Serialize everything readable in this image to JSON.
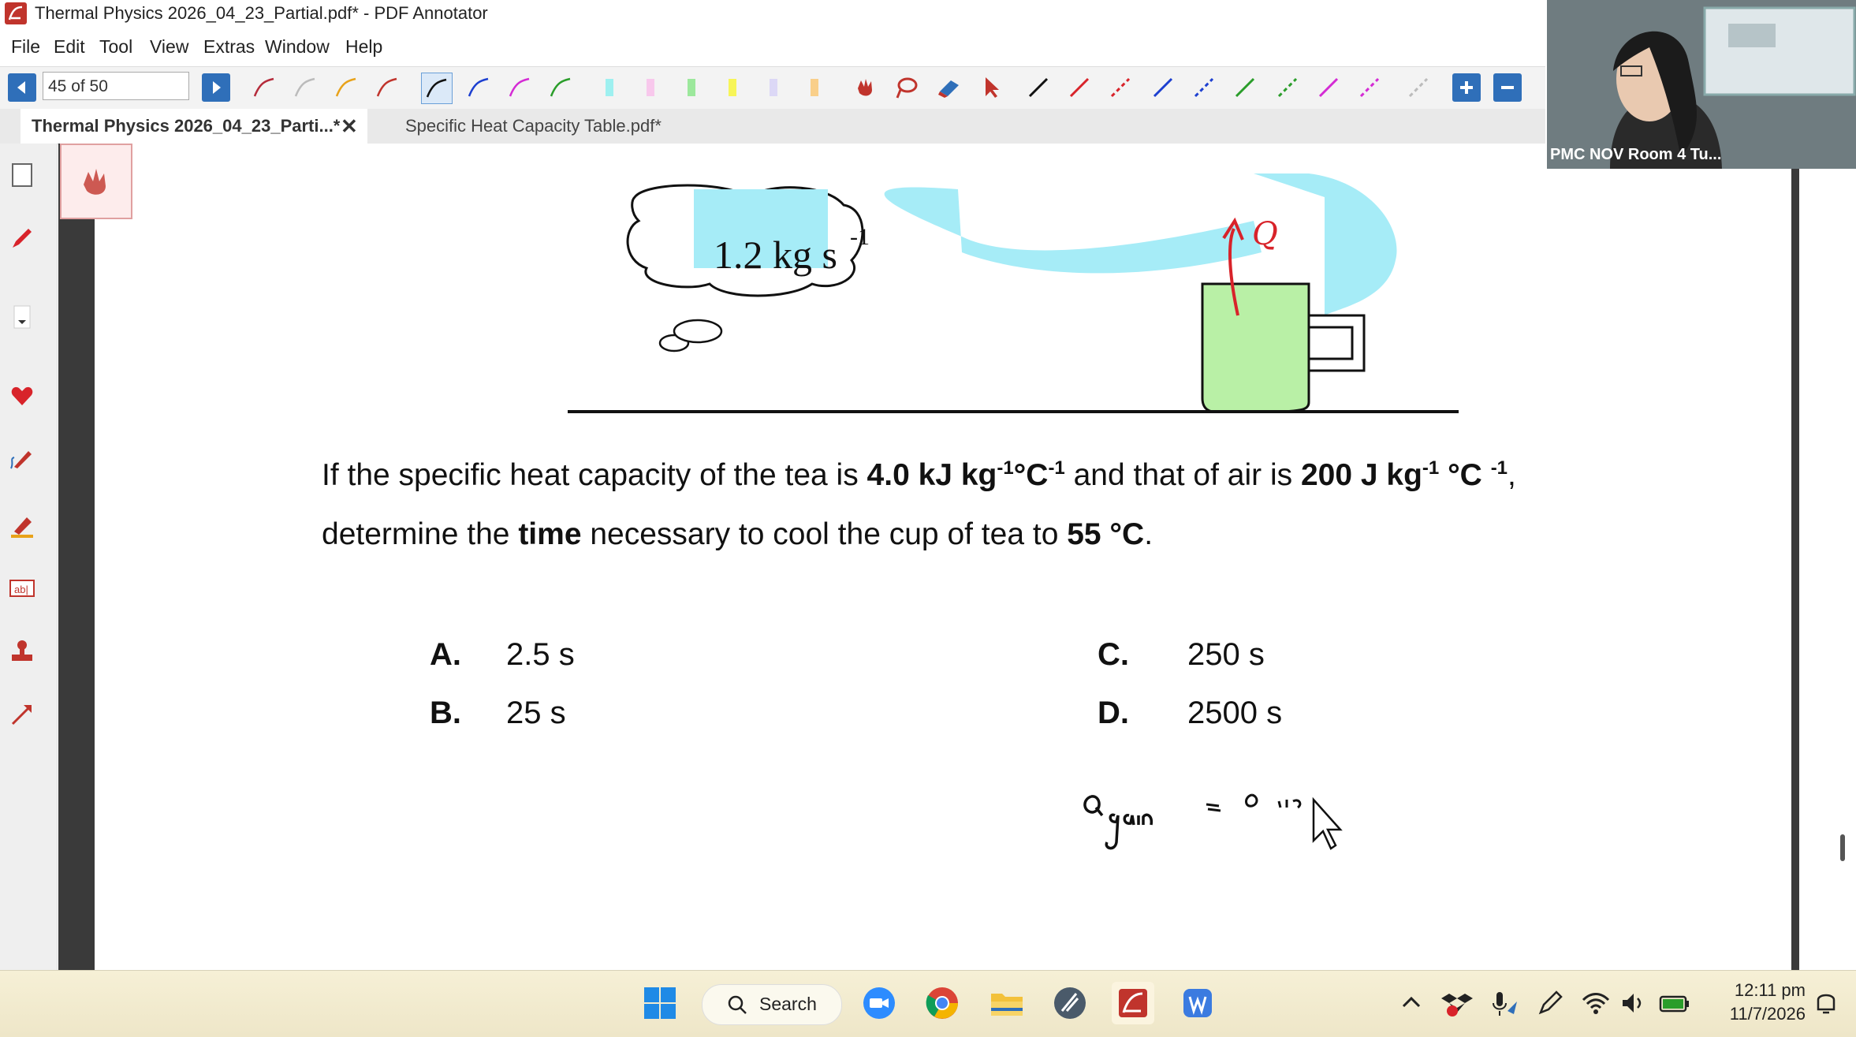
{
  "window": {
    "title": "Thermal Physics 2026_04_23_Partial.pdf* - PDF Annotator"
  },
  "menu": [
    "File",
    "Edit",
    "Tool",
    "View",
    "Extras",
    "Window",
    "Help"
  ],
  "toolbar": {
    "page_indicator": "45 of 50"
  },
  "tabs": [
    {
      "label": "Thermal Physics 2026_04_23_Parti...*",
      "close": "✕"
    },
    {
      "label": "Specific Heat Capacity Table.pdf*"
    }
  ],
  "diagram": {
    "cloud_label": "1.2 kg s",
    "cloud_label_exp": "-1",
    "arrow_label": "Q"
  },
  "question": {
    "line1_a": "If the specific heat capacity of the tea is ",
    "line1_b": "4.0 kJ kg",
    "line1_b_sup": "-1",
    "line1_c": "°C",
    "line1_c_sup": "-1",
    "line1_d": " and that of air is ",
    "line1_e": "200 J kg",
    "line1_e_sup": "-1",
    "line1_f": " °C ",
    "line1_f_sup": "-1",
    "line1_g": ",",
    "line2_a": "determine the ",
    "line2_b": "time",
    "line2_c": " necessary to cool the cup of tea to ",
    "line2_d": "55 °C",
    "line2_e": "."
  },
  "options": [
    {
      "letter": "A.",
      "value": "2.5 s"
    },
    {
      "letter": "B.",
      "value": "25 s"
    },
    {
      "letter": "C.",
      "value": "250 s"
    },
    {
      "letter": "D.",
      "value": "2500 s"
    }
  ],
  "webcam": {
    "label": "PMC NOV Room 4 Tu..."
  },
  "taskbar": {
    "search": "Search",
    "time": "12:11 pm",
    "date": "11/7/2026"
  },
  "icons": {
    "toolbar": [
      "prev-page-icon",
      "next-page-icon",
      "pen-icons",
      "highlighter-icons",
      "hand-icon",
      "lasso-icon",
      "eraser-icon",
      "pointer-icon",
      "line-icons",
      "zoom-in-icon",
      "zoom-out-icon"
    ],
    "taskbar": [
      "windows-start-icon",
      "search-icon",
      "zoom-icon",
      "chrome-icon",
      "file-explorer-icon",
      "unknown-app-icon",
      "pdf-annotator-icon",
      "whiteboard-icon"
    ]
  },
  "colors": {
    "accent": "#2f6fb9",
    "annotation_red": "#c0342c",
    "cyan_highlight": "#a6ecf7",
    "green_highlight": "#b9f0a6"
  }
}
